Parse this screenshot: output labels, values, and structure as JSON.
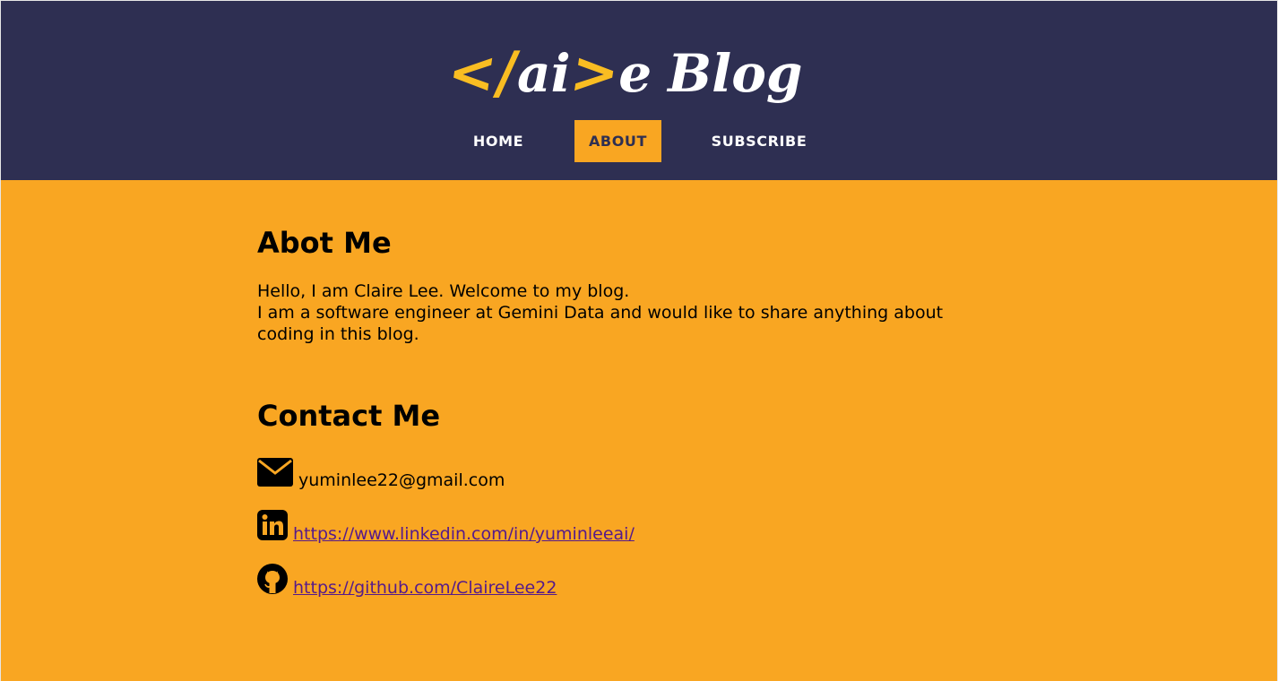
{
  "header": {
    "logo": {
      "open_bracket": "</",
      "middle": "ai",
      "close_bracket": ">",
      "tail": "e",
      "blog": "Blog"
    },
    "nav": [
      {
        "label": "HOME",
        "active": false
      },
      {
        "label": "ABOUT",
        "active": true
      },
      {
        "label": "SUBSCRIBE",
        "active": false
      }
    ]
  },
  "about": {
    "title": "Abot Me",
    "line1": "Hello, I am Claire Lee. Welcome to my blog.",
    "line2": "I am a software engineer at Gemini Data and would like to share anything about coding in this blog."
  },
  "contact": {
    "title": "Contact Me",
    "email": "yuminlee22@gmail.com",
    "linkedin": "https://www.linkedin.com/in/yuminleeai/",
    "github": "https://github.com/ClaireLee22"
  },
  "colors": {
    "header_bg": "#2e2f52",
    "page_bg": "#f9a622",
    "logo_accent": "#f9bd22",
    "link": "#551a8b"
  },
  "icons": {
    "email": "envelope-icon",
    "linkedin": "linkedin-icon",
    "github": "github-icon"
  }
}
